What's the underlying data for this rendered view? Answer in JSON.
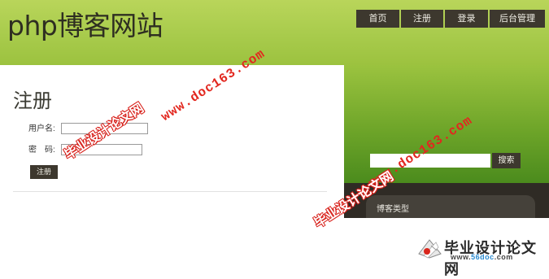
{
  "site": {
    "title": "php博客网站"
  },
  "nav": {
    "items": [
      "首页",
      "注册",
      "登录",
      "后台管理"
    ]
  },
  "register": {
    "heading": "注册",
    "username_label": "用户名:",
    "password_label": "密　码:",
    "username_value": "",
    "password_value": "",
    "submit_label": "注册"
  },
  "sidebar": {
    "search_placeholder": "",
    "search_button": "搜索",
    "category_title": "博客类型"
  },
  "watermarks": {
    "url": "www.doc163.com",
    "cn": "毕业设计论文网"
  },
  "logo": {
    "cn": "毕业设计论文网",
    "url_prefix": "www.",
    "url_domain": "56doc",
    "url_suffix": ".com"
  },
  "colors": {
    "header_green": "#a8cb4c",
    "nav_dark": "#3d382e",
    "watermark_red": "#e2271f"
  }
}
